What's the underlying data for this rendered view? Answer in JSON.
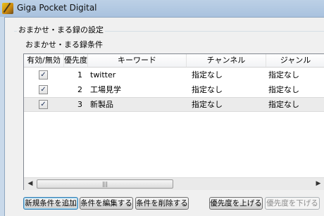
{
  "window": {
    "title": "Giga Pocket Digital"
  },
  "group": {
    "title": "おまかせ・まる録の設定"
  },
  "list": {
    "label": "おまかせ・まる録条件",
    "columns": [
      "有効/無効",
      "優先度",
      "キーワード",
      "チャンネル",
      "ジャンル"
    ],
    "rows": [
      {
        "enabled": "✓",
        "priority": "1",
        "keyword": "twitter",
        "channel": "指定なし",
        "genre": "指定なし",
        "selected": false
      },
      {
        "enabled": "✓",
        "priority": "2",
        "keyword": "工場見学",
        "channel": "指定なし",
        "genre": "指定なし",
        "selected": false
      },
      {
        "enabled": "✓",
        "priority": "3",
        "keyword": "新製品",
        "channel": "指定なし",
        "genre": "指定なし",
        "selected": true
      }
    ],
    "scrollbar": {
      "left": "◀",
      "right": "▶",
      "grip": "|||"
    }
  },
  "buttons": {
    "add": "新規条件を追加",
    "edit": "条件を編集する",
    "delete": "条件を削除する",
    "raise": "優先度を上げる",
    "lower": "優先度を下げる"
  }
}
